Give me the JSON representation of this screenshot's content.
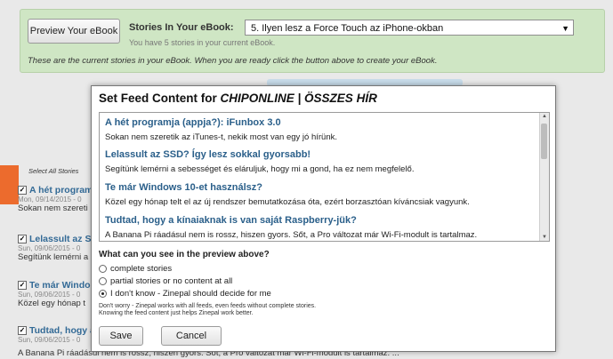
{
  "top_panel": {
    "preview_button": "Preview Your eBook",
    "stories_label": "Stories In Your eBook:",
    "selected_story": "5. Ilyen lesz a Force Touch az iPhone-okban",
    "stories_count_note": "You have 5 stories in your current eBook.",
    "info_text": "These are the current stories in your eBook. When you are ready click the button above to create your eBook."
  },
  "background_list": {
    "select_all": "Select All Stories",
    "items": [
      {
        "title": "A hét program",
        "date": "Mon, 09/14/2015 - 0",
        "snippet": "Sokan nem szereti"
      },
      {
        "title": "Lelassult az S",
        "date": "Sun, 09/06/2015 - 0",
        "snippet": "Segítünk lemérni a"
      },
      {
        "title": "Te már Windo",
        "date": "Sun, 09/06/2015 - 0",
        "snippet": "Közel egy hónap t"
      },
      {
        "title": "Tudtad, hogy a",
        "date": "Sun, 09/06/2015 - 0",
        "snippet": ""
      }
    ],
    "bottom_snippet": "A Banana Pi ráadásul nem is rossz, hiszen gyors. Sőt, a Pro változat már Wi-Fi-modult is tartalmaz. ..."
  },
  "modal": {
    "title_prefix": "Set Feed Content for ",
    "title_feed": "CHIPONLINE | ÖSSZES HÍR",
    "preview_items": [
      {
        "title": "A hét programja (appja?): iFunbox 3.0",
        "summary": "Sokan nem szeretik az iTunes-t, nekik most van egy jó hírünk."
      },
      {
        "title": "Lelassult az SSD? Így lesz sokkal gyorsabb!",
        "summary": "Segítünk lemérni a sebességet és eláruljuk, hogy mi a gond, ha ez nem megfelelő."
      },
      {
        "title": "Te már Windows 10-et használsz?",
        "summary": "Közel egy hónap telt el az új rendszer bemutatkozása óta, ezért borzasztóan kíváncsiak vagyunk."
      },
      {
        "title": "Tudtad, hogy a kínaiaknak is van saját Raspberry-jük?",
        "summary": "A Banana Pi ráadásul nem is rossz, hiszen gyors. Sőt, a Pro változat már Wi-Fi-modult is tartalmaz."
      }
    ],
    "question": "What can you see in the preview above?",
    "options": [
      "complete stories",
      "partial stories or no content at all",
      "I don't know - Zinepal should decide for me"
    ],
    "selected_option": 2,
    "dont_worry_1": "Don't worry - Zinepal works with all feeds, even feeds without complete stories.",
    "dont_worry_2": "Knowing the feed content just helps Zinepal work better.",
    "save_label": "Save",
    "cancel_label": "Cancel"
  },
  "colors": {
    "panel_green": "#cfe6c4",
    "link_blue": "#2a5f8a",
    "accent_orange": "#ec6b2d"
  }
}
